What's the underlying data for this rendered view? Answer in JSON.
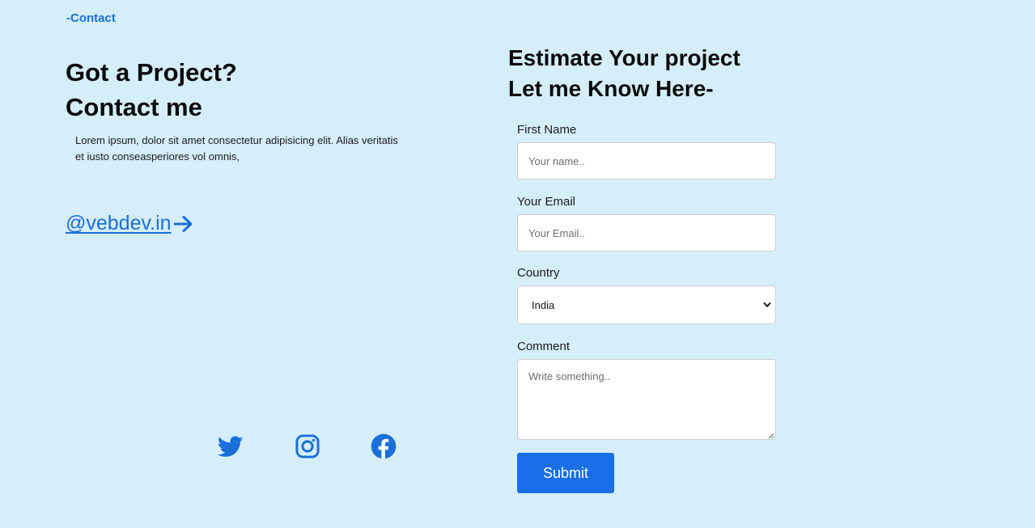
{
  "section_tag": "-Contact",
  "left": {
    "heading_line1": "Got a Project?",
    "heading_line2": "Contact me",
    "description": "Lorem ipsum, dolor sit amet consectetur adipisicing elit. Alias veritatis et iusto conseasperiores vol omnis,",
    "handle": "@vebdev.in ",
    "handle_icon": "arrow-right-icon"
  },
  "socials": [
    {
      "name": "twitter",
      "icon": "twitter-icon"
    },
    {
      "name": "instagram",
      "icon": "instagram-icon"
    },
    {
      "name": "facebook",
      "icon": "facebook-icon"
    }
  ],
  "right": {
    "heading_line1": "Estimate Your project",
    "heading_line2": "Let me Know Here-"
  },
  "form": {
    "first_name": {
      "label": "First Name",
      "placeholder": "Your name..",
      "value": ""
    },
    "email": {
      "label": "Your Email",
      "placeholder": "Your Email..",
      "value": ""
    },
    "country": {
      "label": "Country",
      "selected": "India"
    },
    "comment": {
      "label": "Comment",
      "placeholder": "Write something..",
      "value": ""
    },
    "submit_label": "Submit"
  },
  "colors": {
    "background": "#d5eefa",
    "accent": "#1a6fdb",
    "button": "#1a6fe8",
    "text": "#0a0a0a"
  }
}
